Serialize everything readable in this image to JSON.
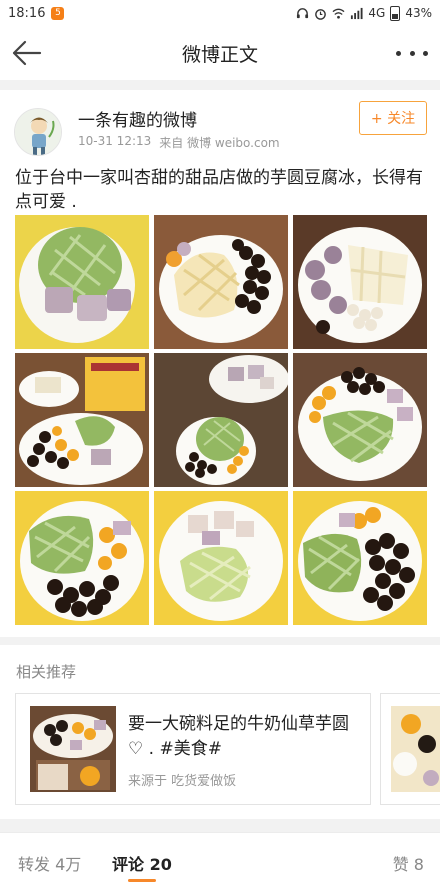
{
  "status_bar": {
    "time": "18:16",
    "notification_badge": "5",
    "network": "4G",
    "battery": "43%"
  },
  "nav": {
    "title": "微博正文"
  },
  "post": {
    "author": "一条有趣的微博",
    "date": "10-31 12:13",
    "source": "来自 微博 weibo.com",
    "follow_label": "+ 关注",
    "text": "位于台中一家叫杏甜的甜品店做的芋圆豆腐冰，长得有点可爱 .",
    "images": [
      {
        "icon": "dessert-photo-1"
      },
      {
        "icon": "dessert-photo-2"
      },
      {
        "icon": "dessert-photo-3"
      },
      {
        "icon": "dessert-photo-4"
      },
      {
        "icon": "dessert-photo-5"
      },
      {
        "icon": "dessert-photo-6"
      },
      {
        "icon": "dessert-photo-7"
      },
      {
        "icon": "dessert-photo-8"
      },
      {
        "icon": "dessert-photo-9"
      }
    ]
  },
  "related": {
    "title": "相关推荐",
    "card": {
      "title": "要一大碗料足的牛奶仙草芋圆 ♡ . #美食#",
      "source": "来源于 吃货爱做饭"
    }
  },
  "tabs": {
    "repost": "转发 4万",
    "comment": "评论 20",
    "like": "赞 8"
  },
  "colors": {
    "accent": "#f7882a",
    "matcha": "#8fb35a",
    "tofu": "#f4ead0",
    "boba": "#2a1a12",
    "taro": "#b7a1b3",
    "mango": "#f2a623"
  }
}
